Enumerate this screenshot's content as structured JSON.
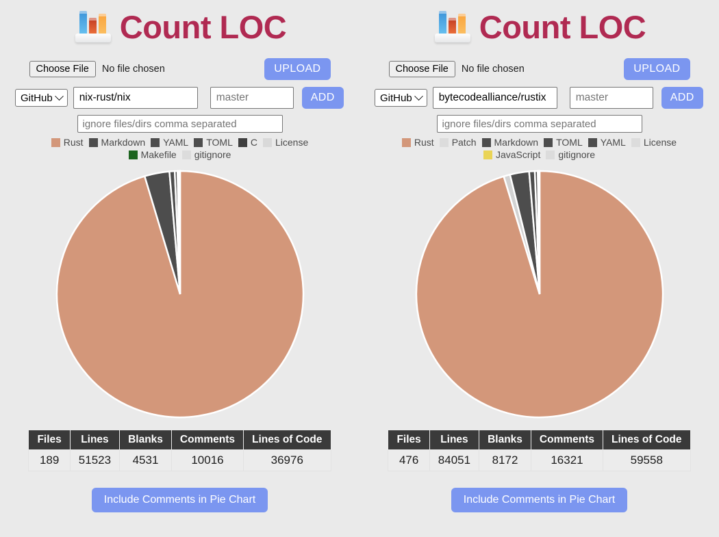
{
  "theme": {
    "background": "#eaeaea",
    "title_color": "#b02a52",
    "accent_button": "#7b96f0",
    "table_header_bg": "#3a3a3a",
    "table_cell_bg": "#ececec"
  },
  "panels": [
    {
      "id": "left",
      "logo_icon": "bar-chart-icon",
      "title": "Count LOC",
      "upload": {
        "choose_file_label": "Choose File",
        "file_status": "No file chosen",
        "upload_label": "UPLOAD"
      },
      "repo": {
        "provider": "GitHub",
        "provider_options": [
          "GitHub"
        ],
        "repo_value": "nix-rust/nix",
        "repo_placeholder": "",
        "branch_value": "",
        "branch_placeholder": "master",
        "add_label": "ADD"
      },
      "ignore": {
        "value": "",
        "placeholder": "ignore files/dirs comma separated"
      },
      "legend": [
        {
          "label": "Rust",
          "color": "#d3977a"
        },
        {
          "label": "Markdown",
          "color": "#4d4d4d"
        },
        {
          "label": "YAML",
          "color": "#4d4d4d"
        },
        {
          "label": "TOML",
          "color": "#4d4d4d"
        },
        {
          "label": "C",
          "color": "#3f3f3f"
        },
        {
          "label": "License",
          "color": "#d9d9d9"
        },
        {
          "label": "Makefile",
          "color": "#1d6420"
        },
        {
          "label": "gitignore",
          "color": "#dcdcdc"
        }
      ],
      "chart_data": {
        "type": "pie",
        "title": "Lines of Code by Language",
        "legend_position": "top",
        "labels": [
          "Rust",
          "Markdown",
          "YAML",
          "TOML",
          "C",
          "License",
          "Makefile",
          "gitignore"
        ],
        "values": [
          35260,
          1205,
          255,
          135,
          70,
          30,
          14,
          7
        ],
        "colors": [
          "#d3977a",
          "#4d4d4d",
          "#4d4d4d",
          "#4d4d4d",
          "#3f3f3f",
          "#d9d9d9",
          "#1d6420",
          "#dcdcdc"
        ],
        "unit": "lines of code",
        "total": 36976
      },
      "table": {
        "headers": [
          "Files",
          "Lines",
          "Blanks",
          "Comments",
          "Lines of Code"
        ],
        "rows": [
          [
            "189",
            "51523",
            "4531",
            "10016",
            "36976"
          ]
        ]
      },
      "include_comments_label": "Include Comments in Pie Chart"
    },
    {
      "id": "right",
      "logo_icon": "bar-chart-icon",
      "title": "Count LOC",
      "upload": {
        "choose_file_label": "Choose File",
        "file_status": "No file chosen",
        "upload_label": "UPLOAD"
      },
      "repo": {
        "provider": "GitHub",
        "provider_options": [
          "GitHub"
        ],
        "repo_value": "bytecodealliance/rustix",
        "repo_placeholder": "",
        "branch_value": "",
        "branch_placeholder": "master",
        "add_label": "ADD"
      },
      "ignore": {
        "value": "",
        "placeholder": "ignore files/dirs comma separated"
      },
      "legend": [
        {
          "label": "Rust",
          "color": "#d3977a"
        },
        {
          "label": "Patch",
          "color": "#dcdcdc"
        },
        {
          "label": "Markdown",
          "color": "#4d4d4d"
        },
        {
          "label": "TOML",
          "color": "#4d4d4d"
        },
        {
          "label": "YAML",
          "color": "#4d4d4d"
        },
        {
          "label": "License",
          "color": "#dcdcdc"
        },
        {
          "label": "JavaScript",
          "color": "#ead456"
        },
        {
          "label": "gitignore",
          "color": "#dcdcdc"
        }
      ],
      "chart_data": {
        "type": "pie",
        "title": "Lines of Code by Language",
        "legend_position": "top",
        "labels": [
          "Rust",
          "Patch",
          "Markdown",
          "TOML",
          "YAML",
          "License",
          "JavaScript",
          "gitignore"
        ],
        "values": [
          56760,
          500,
          1490,
          440,
          230,
          80,
          45,
          13
        ],
        "colors": [
          "#d3977a",
          "#d2d2d2",
          "#4d4d4d",
          "#4d4d4d",
          "#4d4d4d",
          "#dcdcdc",
          "#ead456",
          "#dcdcdc"
        ],
        "unit": "lines of code",
        "total": 59558
      },
      "table": {
        "headers": [
          "Files",
          "Lines",
          "Blanks",
          "Comments",
          "Lines of Code"
        ],
        "rows": [
          [
            "476",
            "84051",
            "8172",
            "16321",
            "59558"
          ]
        ]
      },
      "include_comments_label": "Include Comments in Pie Chart"
    }
  ]
}
